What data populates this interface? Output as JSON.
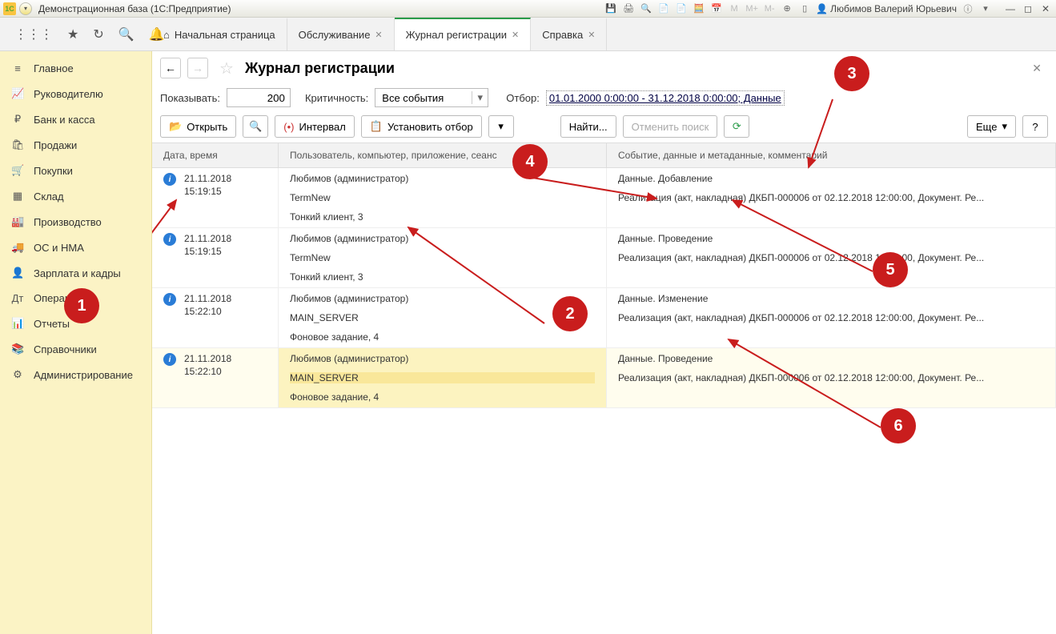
{
  "titlebar": {
    "title": "Демонстрационная база  (1С:Предприятие)",
    "user": "Любимов Валерий Юрьевич"
  },
  "tabs": {
    "home": "Начальная страница",
    "t1": "Обслуживание",
    "t2": "Журнал регистрации",
    "t3": "Справка"
  },
  "sidebar": {
    "items": [
      {
        "icon": "≡",
        "label": "Главное"
      },
      {
        "icon": "📈",
        "label": "Руководителю"
      },
      {
        "icon": "₽",
        "label": "Банк и касса"
      },
      {
        "icon": "🛍",
        "label": "Продажи"
      },
      {
        "icon": "🛒",
        "label": "Покупки"
      },
      {
        "icon": "▦",
        "label": "Склад"
      },
      {
        "icon": "🏭",
        "label": "Производство"
      },
      {
        "icon": "🚚",
        "label": "ОС и НМА"
      },
      {
        "icon": "👤",
        "label": "Зарплата и кадры"
      },
      {
        "icon": "Дт",
        "label": "Операции"
      },
      {
        "icon": "📊",
        "label": "Отчеты"
      },
      {
        "icon": "📚",
        "label": "Справочники"
      },
      {
        "icon": "⚙",
        "label": "Администрирование"
      }
    ]
  },
  "page": {
    "title": "Журнал регистрации",
    "show_label": "Показывать:",
    "show_value": "200",
    "crit_label": "Критичность:",
    "crit_value": "Все события",
    "filter_label": "Отбор:",
    "filter_value": "01.01.2000 0:00:00 - 31.12.2018 0:00:00; Данные"
  },
  "toolbar": {
    "open": "Открыть",
    "interval": "Интервал",
    "setfilter": "Установить отбор",
    "find": "Найти...",
    "cancel": "Отменить поиск",
    "more": "Еще"
  },
  "columns": {
    "c1": "Дата, время",
    "c2": "Пользователь, компьютер, приложение, сеанс",
    "c3": "Событие, данные и метаданные, комментарий"
  },
  "rows": [
    {
      "date": "21.11.2018",
      "time": "15:19:15",
      "user": "Любимов (администратор)",
      "comp": "TermNew",
      "app": "Тонкий клиент, 3",
      "event": "Данные. Добавление",
      "doc": "Реализация (акт, накладная) ДКБП-000006 от 02.12.2018 12:00:00, Документ. Ре..."
    },
    {
      "date": "21.11.2018",
      "time": "15:19:15",
      "user": "Любимов (администратор)",
      "comp": "TermNew",
      "app": "Тонкий клиент, 3",
      "event": "Данные. Проведение",
      "doc": "Реализация (акт, накладная) ДКБП-000006 от 02.12.2018 12:00:00, Документ. Ре..."
    },
    {
      "date": "21.11.2018",
      "time": "15:22:10",
      "user": "Любимов (администратор)",
      "comp": "MAIN_SERVER",
      "app": "Фоновое задание, 4",
      "event": "Данные. Изменение",
      "doc": "Реализация (акт, накладная) ДКБП-000006 от 02.12.2018 12:00:00, Документ. Ре..."
    },
    {
      "date": "21.11.2018",
      "time": "15:22:10",
      "user": "Любимов (администратор)",
      "comp": "MAIN_SERVER",
      "app": "Фоновое задание, 4",
      "event": "Данные. Проведение",
      "doc": "Реализация (акт, накладная) ДКБП-000006 от 02.12.2018 12:00:00, Документ. Ре..."
    }
  ],
  "callouts": [
    "1",
    "2",
    "3",
    "4",
    "5",
    "6"
  ]
}
